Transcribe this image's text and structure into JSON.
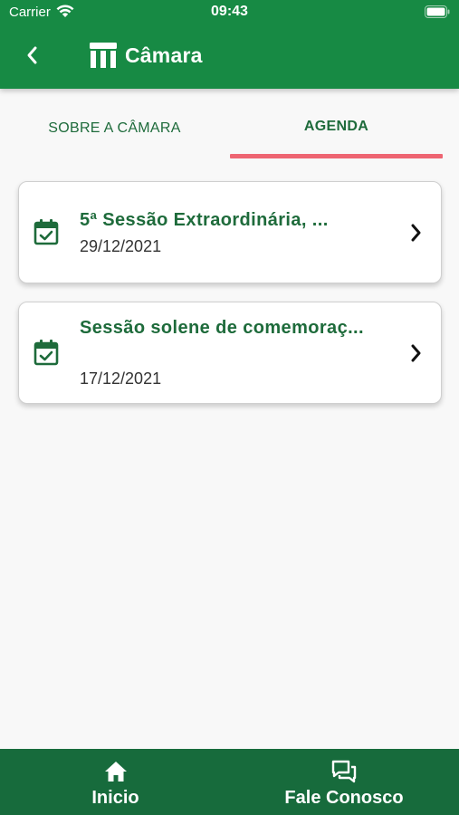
{
  "status_bar": {
    "carrier": "Carrier",
    "time": "09:43"
  },
  "header": {
    "title": "Câmara",
    "back_icon": "chevron-left-icon",
    "title_icon": "building-columns-icon",
    "background": "#178a44"
  },
  "tabs": [
    {
      "label": "SOBRE A CÂMARA",
      "active": false
    },
    {
      "label": "AGENDA",
      "active": true
    }
  ],
  "tab_indicator_color": "#ee6572",
  "agenda": [
    {
      "title": "5ª Sessão Extraordinária, ...",
      "date": "29/12/2021",
      "icon": "calendar-check-icon"
    },
    {
      "title": "Sessão solene de comemoraç...",
      "date": "17/12/2021",
      "icon": "calendar-check-icon"
    }
  ],
  "bottom_nav": [
    {
      "label": "Inicio",
      "icon": "home-icon"
    },
    {
      "label": "Fale Conosco",
      "icon": "chat-bubbles-icon"
    }
  ],
  "colors": {
    "primary_green": "#178a44",
    "text_green": "#1e6b3b",
    "bottom_nav": "#176b3c"
  }
}
